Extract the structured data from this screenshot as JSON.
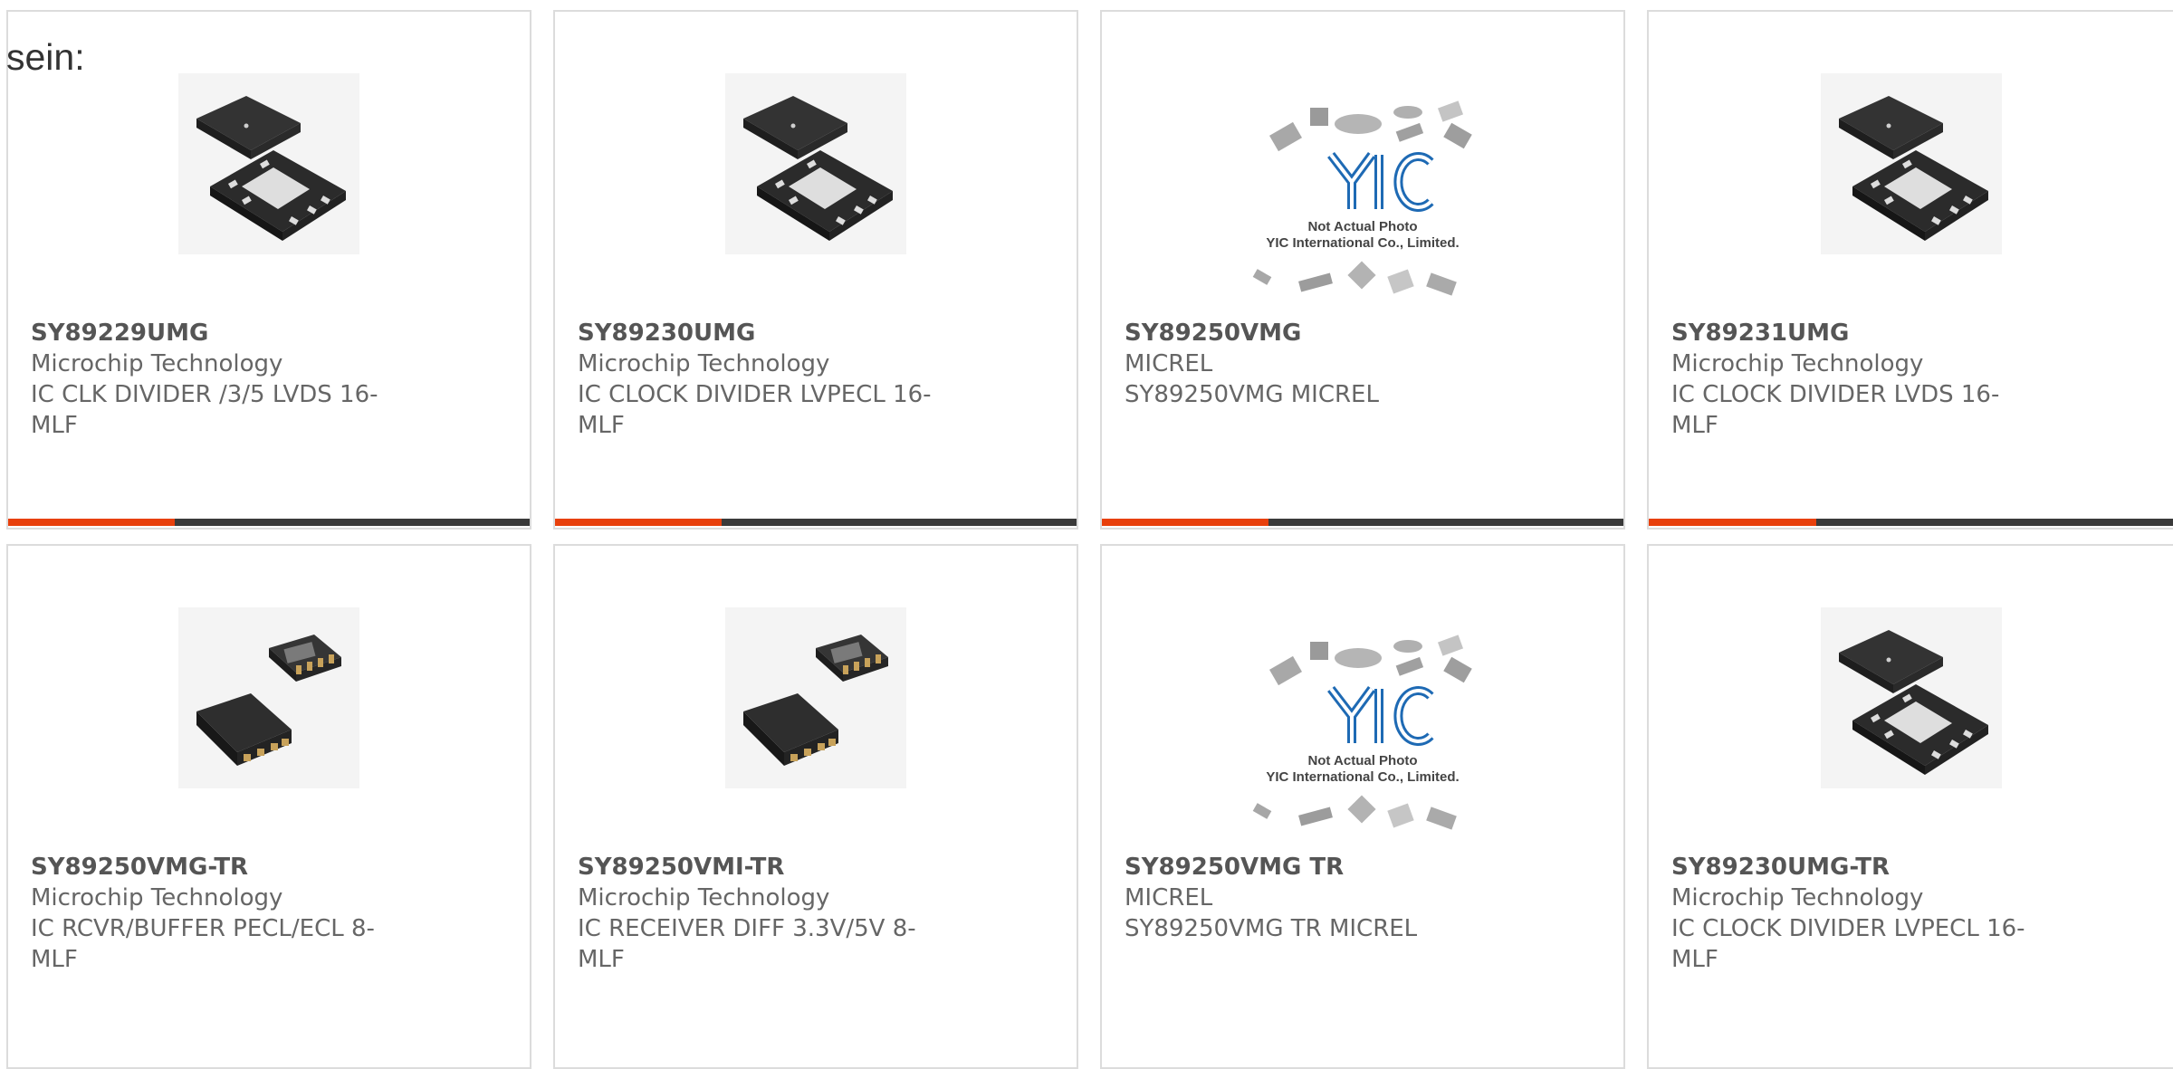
{
  "lead_text": "sein:",
  "colors": {
    "accent": "#e8400c",
    "bar": "#3a3a3a",
    "border": "#dcdcdc"
  },
  "cards": [
    {
      "part": "SY89229UMG",
      "maker": "Microchip Technology",
      "desc": "IC CLK DIVIDER /3/5 LVDS 16-",
      "desc2": "MLF",
      "image": "qfn-chip-icon",
      "progress": 0.32
    },
    {
      "part": "SY89230UMG",
      "maker": "Microchip Technology",
      "desc": "IC CLOCK DIVIDER LVPECL 16-",
      "desc2": "MLF",
      "image": "qfn-chip-icon",
      "progress": 0.32
    },
    {
      "part": "SY89250VMG",
      "maker": "MICREL",
      "desc": "SY89250VMG MICREL",
      "desc2": "",
      "image": "yic-placeholder-icon",
      "placeholder_line1": "Not Actual Photo",
      "placeholder_line2": "YIC International Co., Limited.",
      "placeholder_logo": "YIC",
      "progress": 0.32
    },
    {
      "part": "SY89231UMG",
      "maker": "Microchip Technology",
      "desc": "IC CLOCK DIVIDER LVDS 16-MLF",
      "desc2": "",
      "image": "qfn-chip-icon",
      "progress": 0.32
    },
    {
      "part": "SY89250VMG-TR",
      "maker": "Microchip Technology",
      "desc": "IC RCVR/BUFFER PECL/ECL 8-",
      "desc2": "MLF",
      "image": "dfn-chip-icon"
    },
    {
      "part": "SY89250VMI-TR",
      "maker": "Microchip Technology",
      "desc": "IC RECEIVER DIFF 3.3V/5V 8-MLF",
      "desc2": "",
      "image": "dfn-chip-icon"
    },
    {
      "part": "SY89250VMG TR",
      "maker": "MICREL",
      "desc": "SY89250VMG TR MICREL",
      "desc2": "",
      "image": "yic-placeholder-icon",
      "placeholder_line1": "Not Actual Photo",
      "placeholder_line2": "YIC International Co., Limited.",
      "placeholder_logo": "YIC"
    },
    {
      "part": "SY89230UMG-TR",
      "maker": "Microchip Technology",
      "desc": "IC CLOCK DIVIDER LVPECL 16-",
      "desc2": "MLF",
      "image": "qfn-chip-icon"
    }
  ]
}
